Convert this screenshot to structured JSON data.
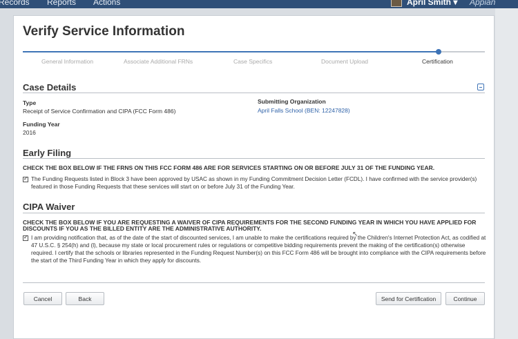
{
  "topbar": {
    "nav": [
      "Records",
      "Reports",
      "Actions"
    ],
    "user_name": "April Smith ▾",
    "brand": "Appian"
  },
  "page": {
    "title": "Verify Service Information"
  },
  "progress": {
    "steps": [
      "General Information",
      "Associate Additional FRNs",
      "Case Specifics",
      "Document Upload",
      "Certification"
    ],
    "active_step": "Certification",
    "completed_fraction": 0.9
  },
  "case_details": {
    "title": "Case Details",
    "type_label": "Type",
    "type_value": "Receipt of Service Confirmation and CIPA (FCC Form 486)",
    "funding_year_label": "Funding Year",
    "funding_year_value": "2016",
    "org_label": "Submitting Organization",
    "org_value": "April Falls School (BEN: 12247828)"
  },
  "early_filing": {
    "title": "Early Filing",
    "instruction": "CHECK THE BOX BELOW IF THE FRNS ON THIS FCC FORM 486 ARE FOR SERVICES STARTING ON OR BEFORE JULY 31 OF THE FUNDING YEAR.",
    "checked": true,
    "text": "The Funding Requests listed in Block 3 have been approved by USAC as shown in my Funding Commitment Decision Letter (FCDL). I have confirmed with the service provider(s) featured in those Funding Requests that these services will start on or before July 31 of the Funding Year."
  },
  "cipa_waiver": {
    "title": "CIPA Waiver",
    "instruction": "CHECK THE BOX BELOW IF YOU ARE REQUESTING A WAIVER OF CIPA REQUIREMENTS FOR THE SECOND FUNDING YEAR IN WHICH YOU HAVE APPLIED FOR DISCOUNTS IF YOU AS THE BILLED ENTITY ARE THE ADMINISTRATIVE AUTHORITY.",
    "checked": true,
    "text": "I am providing notification that, as of the date of the start of discounted services, I am unable to make the certifications required by the Children's Internet Protection Act, as codified at 47 U.S.C. § 254(h) and (l), because my state or local procurement rules or regulations or competitive bidding requirements prevent the making of the certification(s) otherwise required. I certify that the schools or libraries represented in the Funding Request Number(s) on this FCC Form 486 will be brought into compliance with the CIPA requirements before the start of the Third Funding Year in which they apply for discounts."
  },
  "buttons": {
    "cancel": "Cancel",
    "back": "Back",
    "send": "Send for Certification",
    "continue": "Continue"
  },
  "colors": {
    "accent": "#3d73b6",
    "link": "#2f62a8",
    "nav_bg": "#2f4f78"
  }
}
